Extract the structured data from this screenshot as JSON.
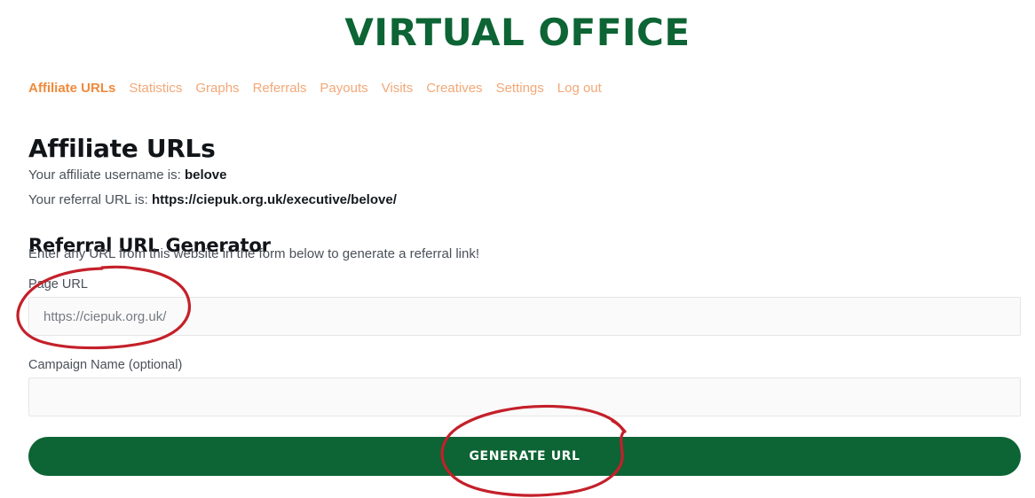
{
  "header": {
    "site_title": "VIRTUAL OFFICE",
    "title_color": "#0d6434"
  },
  "nav": {
    "active_color": "#f08a3c",
    "link_color": "#f2a878",
    "items": [
      {
        "label": "Affiliate URLs",
        "active": true
      },
      {
        "label": "Statistics",
        "active": false
      },
      {
        "label": "Graphs",
        "active": false
      },
      {
        "label": "Referrals",
        "active": false
      },
      {
        "label": "Payouts",
        "active": false
      },
      {
        "label": "Visits",
        "active": false
      },
      {
        "label": "Creatives",
        "active": false
      },
      {
        "label": "Settings",
        "active": false
      },
      {
        "label": "Log out",
        "active": false
      }
    ]
  },
  "main": {
    "page_title": "Affiliate URLs",
    "username_line": {
      "prefix": "Your affiliate username is: ",
      "value": "belove"
    },
    "referral_line": {
      "prefix": "Your referral URL is: ",
      "value": "https://ciepuk.org.uk/executive/belove/"
    },
    "generator": {
      "section_title": "Referral URL Generator",
      "description": "Enter any URL from this website in the form below to generate a referral link!",
      "page_url_label": "Page URL",
      "page_url_value": "",
      "page_url_placeholder": "https://ciepuk.org.uk/",
      "campaign_label": "Campaign Name (optional)",
      "campaign_value": "",
      "campaign_placeholder": "",
      "submit_label": "Generate URL",
      "submit_color": "#0d6434"
    }
  },
  "annotations": {
    "color": "#c4202a",
    "shapes": [
      {
        "name": "page-url-field-circle",
        "target": "page-url-input"
      },
      {
        "name": "generate-url-button-circle",
        "target": "generate-url-button"
      }
    ]
  }
}
